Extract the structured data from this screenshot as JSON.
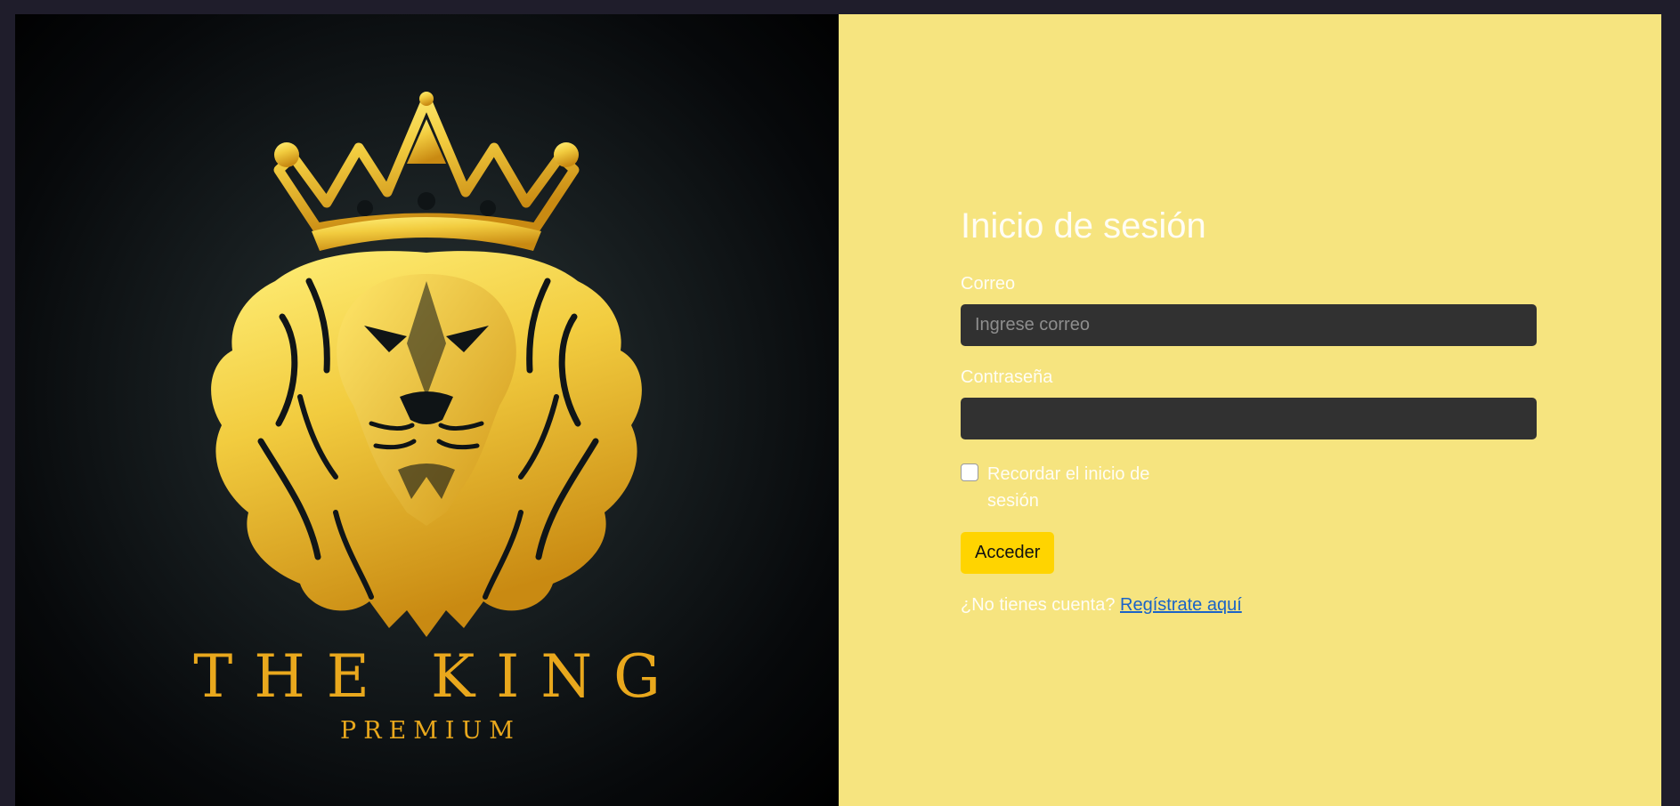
{
  "colors": {
    "page_background": "#1f1d2b",
    "form_panel": "#f6e47f",
    "input_background": "#313131",
    "button": "#ffd400",
    "link": "#1a63c8",
    "logo_gold": "#e9a81d"
  },
  "brand": {
    "logo_icon": "crowned-lion-icon",
    "name": "THE KING",
    "tagline": "PREMIUM"
  },
  "login": {
    "title": "Inicio de sesión",
    "email_label": "Correo",
    "email_placeholder": "Ingrese correo",
    "email_value": "",
    "password_label": "Contraseña",
    "password_value": "",
    "remember_label": "Recordar el inicio de sesión",
    "remember_checked": false,
    "submit_label": "Acceder",
    "register_prompt": "¿No tienes cuenta?",
    "register_link": "Regístrate aquí"
  }
}
